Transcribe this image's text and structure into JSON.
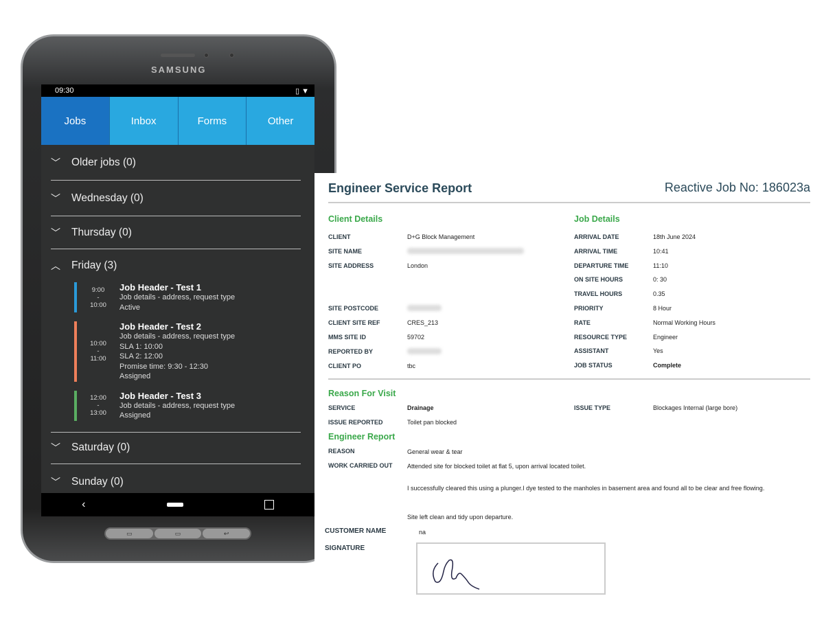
{
  "device": {
    "brand": "SAMSUNG"
  },
  "status_bar": {
    "time": "09:30",
    "icons": [
      "vibrate-icon",
      "wifi-icon"
    ]
  },
  "tabs": [
    {
      "label": "Jobs",
      "active": true
    },
    {
      "label": "Inbox"
    },
    {
      "label": "Forms"
    },
    {
      "label": "Other"
    }
  ],
  "groups": [
    {
      "label": "Older jobs (0)"
    },
    {
      "label": "Wednesday (0)"
    },
    {
      "label": "Thursday (0)"
    },
    {
      "label": "Friday (3)",
      "expanded": true
    },
    {
      "label": "Saturday (0)"
    },
    {
      "label": "Sunday (0)"
    }
  ],
  "jobs": [
    {
      "start": "9:00",
      "sep": "-",
      "end": "10:00",
      "title": "Job Header - Test 1",
      "lines": [
        "Job details - address,  request type",
        "Active"
      ],
      "color": "#2a9ad8"
    },
    {
      "start": "10:00",
      "sep": "-",
      "end": "11:00",
      "title": "Job Header - Test 2",
      "lines": [
        "Job details - address,  request type",
        "SLA 1: 10:00",
        "SLA 2: 12:00",
        "Promise time: 9:30 - 12:30",
        "Assigned"
      ],
      "color": "#ee7f5a"
    },
    {
      "start": "12:00",
      "sep": "-",
      "end": "13:00",
      "title": "Job Header - Test 3",
      "lines": [
        "Job details - address,  request type",
        "Assigned"
      ],
      "color": "#5aae62"
    }
  ],
  "nav_icons": [
    "back-icon",
    "home-icon",
    "recents-icon"
  ],
  "report": {
    "title": "Engineer Service Report",
    "job_no": "Reactive Job No: 186023a",
    "client_heading": "Client Details",
    "job_heading": "Job Details",
    "client": [
      {
        "label": "CLIENT",
        "value": "D+G Block Management"
      },
      {
        "label": "SITE NAME",
        "value": null
      },
      {
        "label": "SITE ADDRESS",
        "value": "London"
      },
      {
        "label": "SITE POSTCODE",
        "value": null
      },
      {
        "label": "CLIENT SITE REF",
        "value": "CRES_213"
      },
      {
        "label": "MMS SITE ID",
        "value": "59702"
      },
      {
        "label": "REPORTED BY",
        "value": null
      },
      {
        "label": "CLIENT PO",
        "value": "tbc"
      }
    ],
    "job": [
      {
        "label": "ARRIVAL DATE",
        "value": "18th June 2024"
      },
      {
        "label": "ARRIVAL TIME",
        "value": "10:41"
      },
      {
        "label": "DEPARTURE TIME",
        "value": "11:10"
      },
      {
        "label": "ON SITE HOURS",
        "value": "0: 30"
      },
      {
        "label": "TRAVEL HOURS",
        "value": "0.35"
      },
      {
        "label": "PRIORITY",
        "value": "8 Hour"
      },
      {
        "label": "RATE",
        "value": "Normal Working Hours"
      },
      {
        "label": "RESOURCE TYPE",
        "value": "Engineer"
      },
      {
        "label": "ASSISTANT",
        "value": "Yes"
      },
      {
        "label": "JOB STATUS",
        "value": "Complete"
      }
    ],
    "reason_heading": "Reason For Visit",
    "service_label": "SERVICE",
    "service": "Drainage",
    "issue_type_label": "ISSUE TYPE",
    "issue_type": "Blockages Internal (large bore)",
    "issue_reported_label": "ISSUE REPORTED",
    "issue_reported": "Toilet pan blocked",
    "engineer_heading": "Engineer Report",
    "reason_label": "REASON",
    "reason": "General wear & tear",
    "work_label": "WORK CARRIED OUT",
    "work": [
      "Attended site for blocked toilet at flat 5, upon arrival located toilet.",
      "I successfully cleared this using a plunger.I dye tested to the manholes in basement area and found all to be clear and free flowing.",
      "Site left clean and tidy upon departure."
    ],
    "customer_label": "CUSTOMER NAME",
    "customer": "na",
    "signature_label": "SIGNATURE"
  }
}
